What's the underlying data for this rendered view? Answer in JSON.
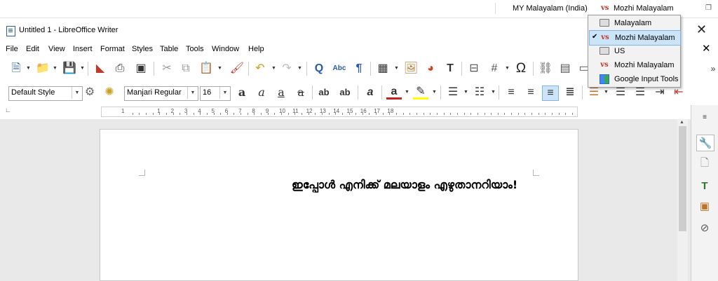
{
  "taskbar": {
    "input_language": "MY Malayalam (India)",
    "ime_name": "Mozhi Malayalam"
  },
  "window": {
    "title": "Untitled 1 - LibreOffice Writer"
  },
  "menu": {
    "items": [
      "File",
      "Edit",
      "View",
      "Insert",
      "Format",
      "Styles",
      "Table",
      "Tools",
      "Window",
      "Help"
    ]
  },
  "formatting": {
    "paragraph_style": "Default Style",
    "font_name": "Manjari Regular",
    "font_size": "16"
  },
  "ruler": {
    "numbers": [
      "1",
      "1",
      "2",
      "3",
      "4",
      "5",
      "6",
      "7",
      "8",
      "9",
      "10",
      "11",
      "12",
      "13",
      "14",
      "15",
      "16",
      "17",
      "18"
    ]
  },
  "document": {
    "text": "ഇപ്പോൾ എനിക്ക് മലയാളം എഴുതാനറിയാം!"
  },
  "language_menu": {
    "items": [
      {
        "label": "Malayalam",
        "icon": "keyboard-icon",
        "selected": false
      },
      {
        "label": "Mozhi Malayalam",
        "icon": "mozhi-icon",
        "selected": true
      },
      {
        "label": "US",
        "icon": "keyboard-icon",
        "selected": false
      },
      {
        "label": "Mozhi Malayalam",
        "icon": "mozhi-icon",
        "selected": false
      },
      {
        "label": "Google Input Tools",
        "icon": "google-input-tools-icon",
        "selected": false
      }
    ]
  },
  "colors": {
    "selection_bg": "#cce4f7",
    "selection_border": "#7eb4ea",
    "mozhi_logo": "#c0392b"
  }
}
